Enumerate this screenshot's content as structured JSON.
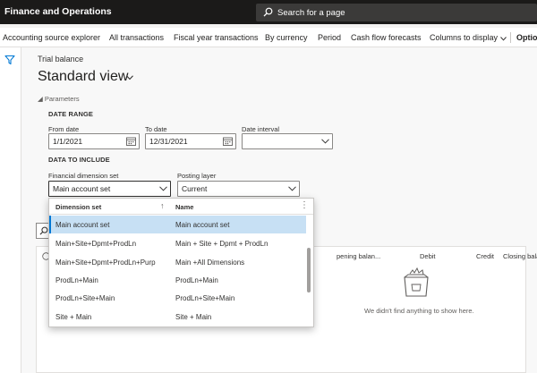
{
  "header": {
    "app_title": "Finance and Operations",
    "search_placeholder": "Search for a page"
  },
  "actions": {
    "items": [
      "Accounting source explorer",
      "All transactions",
      "Fiscal year transactions",
      "By currency",
      "Period",
      "Cash flow forecasts",
      "Columns to display"
    ],
    "overflow_label": "Optio"
  },
  "page": {
    "breadcrumb": "Trial balance",
    "view_title": "Standard view",
    "params_label": "Parameters"
  },
  "parameters": {
    "date_range": {
      "section_label": "DATE RANGE",
      "from_label": "From date",
      "from_value": "1/1/2021",
      "to_label": "To date",
      "to_value": "12/31/2021",
      "interval_label": "Date interval",
      "interval_value": ""
    },
    "include": {
      "section_label": "DATA TO INCLUDE",
      "dimension_label": "Financial dimension set",
      "dimension_value": "Main account set",
      "posting_label": "Posting layer",
      "posting_value": "Current"
    }
  },
  "grid": {
    "columns": [
      "pening balan...",
      "Debit",
      "Credit",
      "Closing balance"
    ],
    "empty_message": "We didn't find anything to show here."
  },
  "dropdown": {
    "columns": [
      "Dimension set",
      "Name"
    ],
    "rows": [
      {
        "set": "Main account set",
        "name": "Main account set",
        "selected": true
      },
      {
        "set": "Main+Site+Dpmt+ProdLn",
        "name": "Main + Site + Dpmt + ProdLn",
        "selected": false
      },
      {
        "set": "Main+Site+Dpmt+ProdLn+Purp",
        "name": "Main +All Dimensions",
        "selected": false
      },
      {
        "set": "ProdLn+Main",
        "name": "ProdLn+Main",
        "selected": false
      },
      {
        "set": "ProdLn+Site+Main",
        "name": "ProdLn+Site+Main",
        "selected": false
      },
      {
        "set": "Site + Main",
        "name": "Site + Main",
        "selected": false
      }
    ]
  },
  "colors": {
    "topbar": "#1b1a19",
    "accent": "#0078d4",
    "selected_row": "#c7e0f4",
    "annotation_arrow": "#7030a0"
  }
}
